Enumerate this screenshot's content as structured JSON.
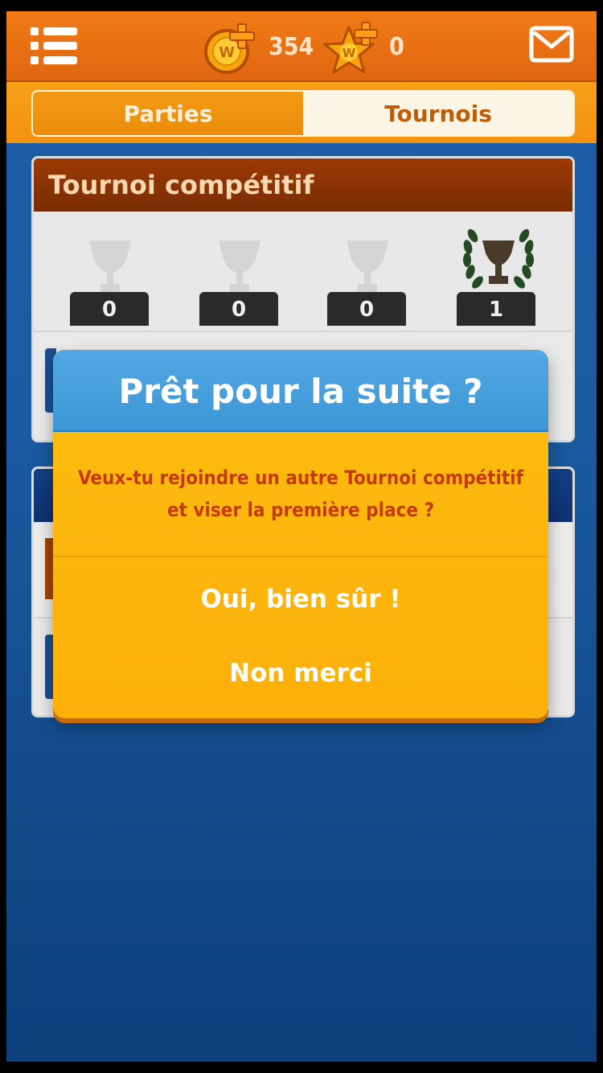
{
  "header": {
    "coins_value": "354",
    "stars_value": "0",
    "coin_letter": "W",
    "star_letter": "W"
  },
  "tabs": [
    {
      "label": "Parties",
      "active": false
    },
    {
      "label": "Tournois",
      "active": true
    }
  ],
  "tournament": {
    "title": "Tournoi compétitif",
    "trophy_counts": [
      "0",
      "0",
      "0",
      "1"
    ]
  },
  "dialog": {
    "title": "Prêt pour la suite ?",
    "message": "Veux-tu rejoindre un autre Tournoi compétitif et viser la première place ?",
    "confirm_label": "Oui, bien sûr !",
    "cancel_label": "Non merci"
  },
  "colors": {
    "header_orange": "#f17b16",
    "tab_strip": "#f7a01a",
    "dialog_blue": "#4aa2de",
    "dialog_yellow": "#fdb70e",
    "message_red": "#c53a10",
    "background_blue": "#1a5aa0"
  }
}
